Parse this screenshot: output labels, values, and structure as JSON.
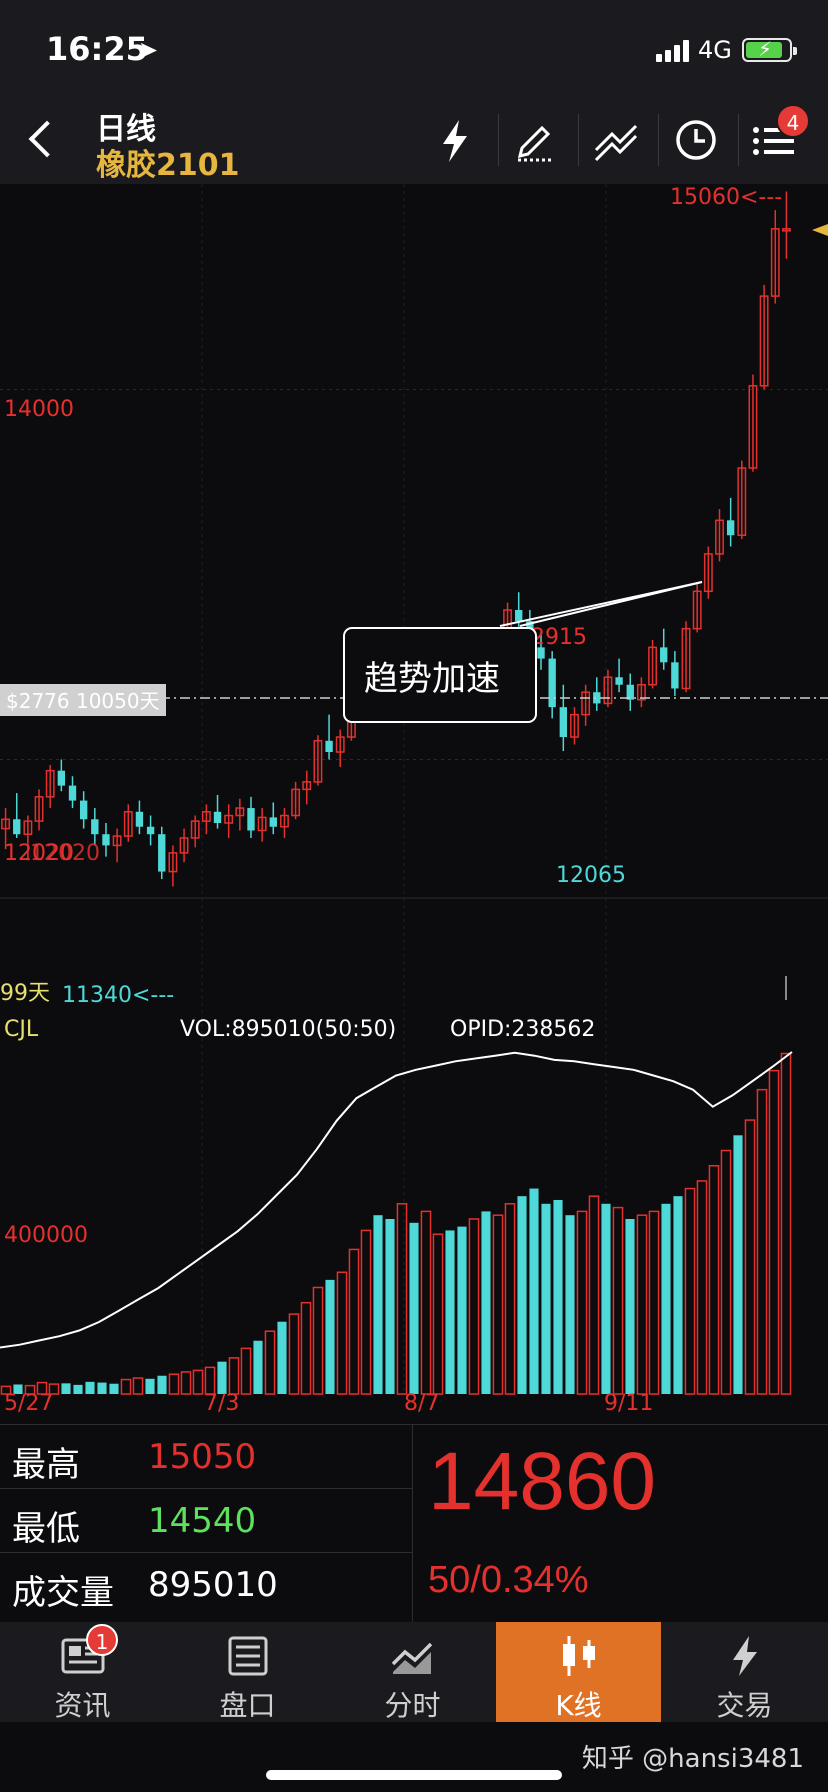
{
  "status": {
    "time": "16:25",
    "network": "4G"
  },
  "nav": {
    "title": "日线",
    "contract": "橡胶2101",
    "badge_count": "4"
  },
  "chart": {
    "max_label": "15060<---",
    "min_label": "11340<---",
    "level_14000": "14000",
    "level_12020": "12020",
    "overlap_label_left": "12020",
    "peak_label": "12915",
    "trough_label": "12065",
    "cursor_tag": "$2776 10050天",
    "days_label": "99天",
    "annotation": "趋势加速",
    "volume_label": "400000",
    "cjl": "CJL",
    "vol": "VOL:895010(50:50)",
    "opid": "OPID:238562",
    "dates": [
      "5/27",
      "7/3",
      "8/7",
      "9/11"
    ]
  },
  "chart_data": {
    "type": "candlestick",
    "title": "橡胶2101 日线",
    "ylim": [
      11300,
      15100
    ],
    "highlights": {
      "high": 15060,
      "low": 11340,
      "swing_high": 12915,
      "swing_low": 12065
    },
    "candles": [
      [
        11650,
        11760,
        11540,
        11700
      ],
      [
        11700,
        11840,
        11600,
        11620
      ],
      [
        11620,
        11720,
        11480,
        11690
      ],
      [
        11690,
        11860,
        11640,
        11820
      ],
      [
        11820,
        11990,
        11760,
        11960
      ],
      [
        11960,
        12020,
        11850,
        11880
      ],
      [
        11880,
        11930,
        11760,
        11800
      ],
      [
        11800,
        11850,
        11650,
        11700
      ],
      [
        11700,
        11760,
        11560,
        11620
      ],
      [
        11620,
        11680,
        11500,
        11560
      ],
      [
        11560,
        11650,
        11470,
        11610
      ],
      [
        11610,
        11780,
        11580,
        11740
      ],
      [
        11740,
        11800,
        11620,
        11660
      ],
      [
        11660,
        11720,
        11560,
        11620
      ],
      [
        11620,
        11660,
        11380,
        11420
      ],
      [
        11420,
        11560,
        11340,
        11520
      ],
      [
        11520,
        11650,
        11470,
        11600
      ],
      [
        11600,
        11720,
        11550,
        11690
      ],
      [
        11690,
        11780,
        11620,
        11740
      ],
      [
        11740,
        11830,
        11650,
        11680
      ],
      [
        11680,
        11780,
        11600,
        11720
      ],
      [
        11720,
        11810,
        11640,
        11760
      ],
      [
        11760,
        11820,
        11600,
        11640
      ],
      [
        11640,
        11760,
        11580,
        11710
      ],
      [
        11710,
        11790,
        11620,
        11660
      ],
      [
        11660,
        11760,
        11600,
        11720
      ],
      [
        11720,
        11900,
        11700,
        11860
      ],
      [
        11860,
        11960,
        11780,
        11900
      ],
      [
        11900,
        12150,
        11880,
        12120
      ],
      [
        12120,
        12260,
        12020,
        12060
      ],
      [
        12060,
        12180,
        11980,
        12140
      ],
      [
        12140,
        12420,
        12120,
        12380
      ],
      [
        12380,
        12560,
        12250,
        12480
      ],
      [
        12480,
        12620,
        12320,
        12360
      ],
      [
        12360,
        12470,
        12220,
        12280
      ],
      [
        12280,
        12500,
        12260,
        12440
      ],
      [
        12440,
        12520,
        12310,
        12360
      ],
      [
        12360,
        12460,
        12280,
        12410
      ],
      [
        12410,
        12540,
        12360,
        12480
      ],
      [
        12480,
        12560,
        12360,
        12400
      ],
      [
        12400,
        12440,
        12300,
        12360
      ],
      [
        12360,
        12600,
        12340,
        12560
      ],
      [
        12560,
        12680,
        12480,
        12620
      ],
      [
        12620,
        12700,
        12480,
        12520
      ],
      [
        12520,
        12640,
        12500,
        12600
      ],
      [
        12600,
        12860,
        12580,
        12820
      ],
      [
        12820,
        12915,
        12700,
        12760
      ],
      [
        12760,
        12820,
        12580,
        12620
      ],
      [
        12620,
        12700,
        12500,
        12560
      ],
      [
        12560,
        12600,
        12240,
        12300
      ],
      [
        12300,
        12420,
        12065,
        12140
      ],
      [
        12140,
        12300,
        12100,
        12260
      ],
      [
        12260,
        12420,
        12200,
        12380
      ],
      [
        12380,
        12460,
        12280,
        12320
      ],
      [
        12320,
        12500,
        12300,
        12460
      ],
      [
        12460,
        12560,
        12380,
        12420
      ],
      [
        12420,
        12480,
        12280,
        12340
      ],
      [
        12340,
        12460,
        12300,
        12420
      ],
      [
        12420,
        12660,
        12400,
        12620
      ],
      [
        12620,
        12720,
        12500,
        12540
      ],
      [
        12540,
        12600,
        12360,
        12400
      ],
      [
        12400,
        12760,
        12380,
        12720
      ],
      [
        12720,
        12960,
        12700,
        12920
      ],
      [
        12920,
        13160,
        12880,
        13120
      ],
      [
        13120,
        13360,
        13080,
        13300
      ],
      [
        13300,
        13420,
        13160,
        13220
      ],
      [
        13220,
        13620,
        13200,
        13580
      ],
      [
        13580,
        14080,
        13560,
        14020
      ],
      [
        14020,
        14560,
        14000,
        14500
      ],
      [
        14500,
        14960,
        14460,
        14860
      ],
      [
        14860,
        15060,
        14700,
        14860
      ]
    ],
    "volume": [
      20000,
      25000,
      22000,
      30000,
      26000,
      28000,
      24000,
      32000,
      30000,
      27000,
      38000,
      42000,
      40000,
      48000,
      52000,
      58000,
      62000,
      70000,
      85000,
      95000,
      120000,
      140000,
      165000,
      190000,
      210000,
      240000,
      280000,
      300000,
      320000,
      380000,
      430000,
      470000,
      460000,
      500000,
      450000,
      480000,
      420000,
      430000,
      440000,
      460000,
      480000,
      470000,
      500000,
      520000,
      540000,
      500000,
      510000,
      470000,
      480000,
      520000,
      500000,
      490000,
      460000,
      470000,
      480000,
      500000,
      520000,
      540000,
      560000,
      600000,
      640000,
      680000,
      720000,
      800000,
      850000,
      895010
    ],
    "open_interest": [
      30000,
      32000,
      35000,
      38000,
      42000,
      48000,
      56000,
      64000,
      72000,
      82000,
      92000,
      102000,
      112000,
      124000,
      138000,
      152000,
      170000,
      190000,
      206000,
      214000,
      222000,
      226000,
      229000,
      232000,
      234000,
      236000,
      238000,
      236000,
      233000,
      232000,
      230000,
      228000,
      226000,
      222000,
      218000,
      212000,
      200000,
      208000,
      218000,
      228000,
      238562
    ]
  },
  "quote": {
    "high_label": "最高",
    "high": "15050",
    "low_label": "最低",
    "low": "14540",
    "vol_label": "成交量",
    "vol": "895010",
    "last": "14860",
    "change": "50/0.34%",
    "up_color": "#e5312d",
    "down_color": "#4fd8d8",
    "low_color": "#5fe05f"
  },
  "tabs": [
    {
      "label": "资讯",
      "icon": "news-icon",
      "badge": "1"
    },
    {
      "label": "盘口",
      "icon": "orderbook-icon"
    },
    {
      "label": "分时",
      "icon": "timeshare-icon"
    },
    {
      "label": "K线",
      "icon": "candlestick-icon",
      "active": true
    },
    {
      "label": "交易",
      "icon": "trade-bolt-icon"
    }
  ],
  "watermark": "知乎 @hansi3481"
}
